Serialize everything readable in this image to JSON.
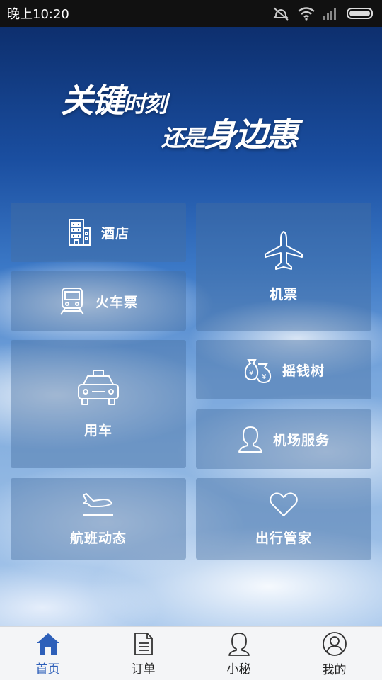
{
  "status_bar": {
    "time": "晚上10:20",
    "icons": [
      "mute-icon",
      "wifi-icon",
      "signal-icon",
      "battery-icon"
    ]
  },
  "banner": {
    "line1_big1": "关键",
    "line1_small": "时刻",
    "line2_small": "还是",
    "line2_big": "身边惠"
  },
  "tiles": {
    "hotel": {
      "label": "酒店",
      "icon": "building-icon"
    },
    "train": {
      "label": "火车票",
      "icon": "train-icon"
    },
    "flight": {
      "label": "机票",
      "icon": "airplane-icon"
    },
    "car": {
      "label": "用车",
      "icon": "taxi-icon"
    },
    "money_tree": {
      "label": "摇钱树",
      "icon": "money-bag-icon"
    },
    "airport": {
      "label": "机场服务",
      "icon": "attendant-icon"
    },
    "flight_status": {
      "label": "航班动态",
      "icon": "plane-landing-icon"
    },
    "butler": {
      "label": "出行管家",
      "icon": "heart-icon"
    }
  },
  "tabbar": {
    "items": [
      {
        "label": "首页",
        "icon": "home-icon",
        "active": true
      },
      {
        "label": "订单",
        "icon": "document-icon",
        "active": false
      },
      {
        "label": "小秘",
        "icon": "assistant-icon",
        "active": false
      },
      {
        "label": "我的",
        "icon": "profile-icon",
        "active": false
      }
    ]
  },
  "colors": {
    "accent": "#2d5fb9",
    "tile_bg": "rgba(70,110,160,0.42)",
    "tabbar_bg": "#f4f5f7"
  }
}
